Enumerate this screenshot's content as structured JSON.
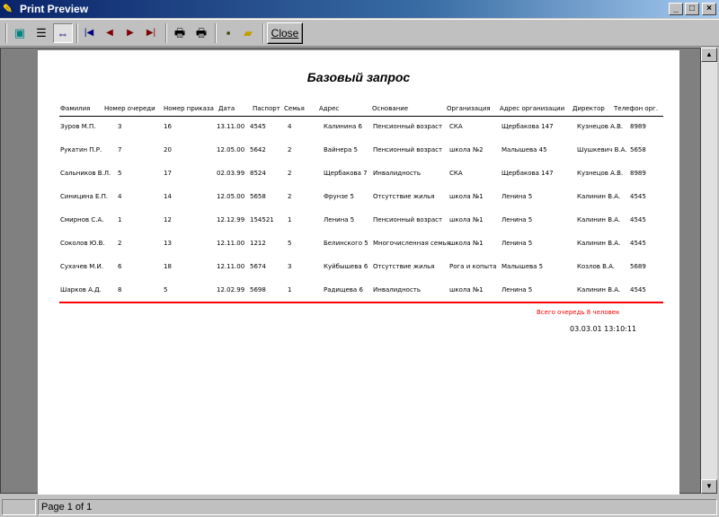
{
  "window": {
    "title": "Print Preview",
    "minimize": "_",
    "maximize": "□",
    "close": "×"
  },
  "toolbar": {
    "close_label": "Close"
  },
  "report": {
    "title": "Базовый запрос",
    "headers": [
      "Фамилия",
      "Номер очереди",
      "Номер приказа",
      "Дата",
      "Паспорт",
      "Семья",
      "Адрес",
      "Основание",
      "Организация",
      "Адрес организации",
      "Директор",
      "Телефон орг."
    ],
    "rows": [
      [
        "Зуров М.П.",
        "3",
        "16",
        "13.11.00",
        "4545",
        "4",
        "Калинина 6",
        "Пенсионный возраст",
        "СКА",
        "Щербакова 147",
        "Кузнецов А.В.",
        "8989"
      ],
      [
        "Рукатин П.Р.",
        "7",
        "20",
        "12.05.00",
        "5642",
        "2",
        "Вайнера 5",
        "Пенсионный возраст",
        "школа №2",
        "Малышева 45",
        "Шушкевич В.А.",
        "5658"
      ],
      [
        "Сальников В.Л.",
        "5",
        "17",
        "02.03.99",
        "8524",
        "2",
        "Щербакова 7",
        "Инвалидность",
        "СКА",
        "Щербакова 147",
        "Кузнецов А.В.",
        "8989"
      ],
      [
        "Синицина Е.П.",
        "4",
        "14",
        "12.05.00",
        "5658",
        "2",
        "Фрунзе 5",
        "Отсутствие жилья",
        "школа №1",
        "Ленина 5",
        "Калинин В.А.",
        "4545"
      ],
      [
        "Смирнов С.А.",
        "1",
        "12",
        "12.12.99",
        "154521",
        "1",
        "Ленина 5",
        "Пенсионный возраст",
        "школа №1",
        "Ленина 5",
        "Калинин В.А.",
        "4545"
      ],
      [
        "Соколов Ю.В.",
        "2",
        "13",
        "12.11.00",
        "1212",
        "5",
        "Белинского 5",
        "Многочисленная семья",
        "школа №1",
        "Ленина 5",
        "Калинин В.А.",
        "4545"
      ],
      [
        "Сухачев М.И.",
        "6",
        "18",
        "12.11.00",
        "5674",
        "3",
        "Куйбышева 6",
        "Отсутствие жилья",
        "Рога и копыта",
        "Малышева 5",
        "Козлов В.А.",
        "5689"
      ],
      [
        "Шарков А.Д.",
        "8",
        "5",
        "12.02.99",
        "5698",
        "1",
        "Радищева 6",
        "Инвалидность",
        "школа №1",
        "Ленина 5",
        "Калинин В.А.",
        "4545"
      ]
    ],
    "total": "Всего очередь 8 человек",
    "printed": "03.03.01 13:10:11"
  },
  "status": {
    "page": "Page 1 of 1"
  }
}
